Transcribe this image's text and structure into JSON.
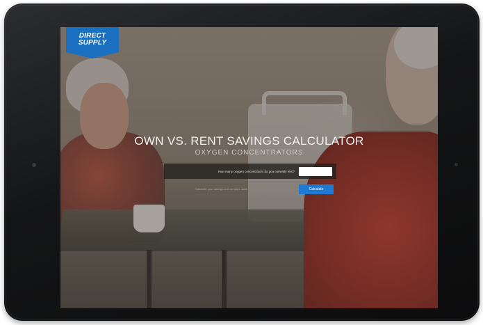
{
  "logo": {
    "line1": "DIRECT",
    "line2": "SUPPLY"
  },
  "hero": {
    "title": "OWN VS. RENT SAVINGS CALCULATOR",
    "subtitle": "OXYGEN CONCENTRATORS"
  },
  "form": {
    "question": "How many oxygen concentrators do you currently rent?",
    "input_value": "",
    "fineprint": "Calculate your savings and compare costs",
    "button_label": "Calculate"
  },
  "colors": {
    "brand_blue": "#1a6fc0",
    "button_blue": "#1f7ad1",
    "device_frame": "#141516"
  }
}
